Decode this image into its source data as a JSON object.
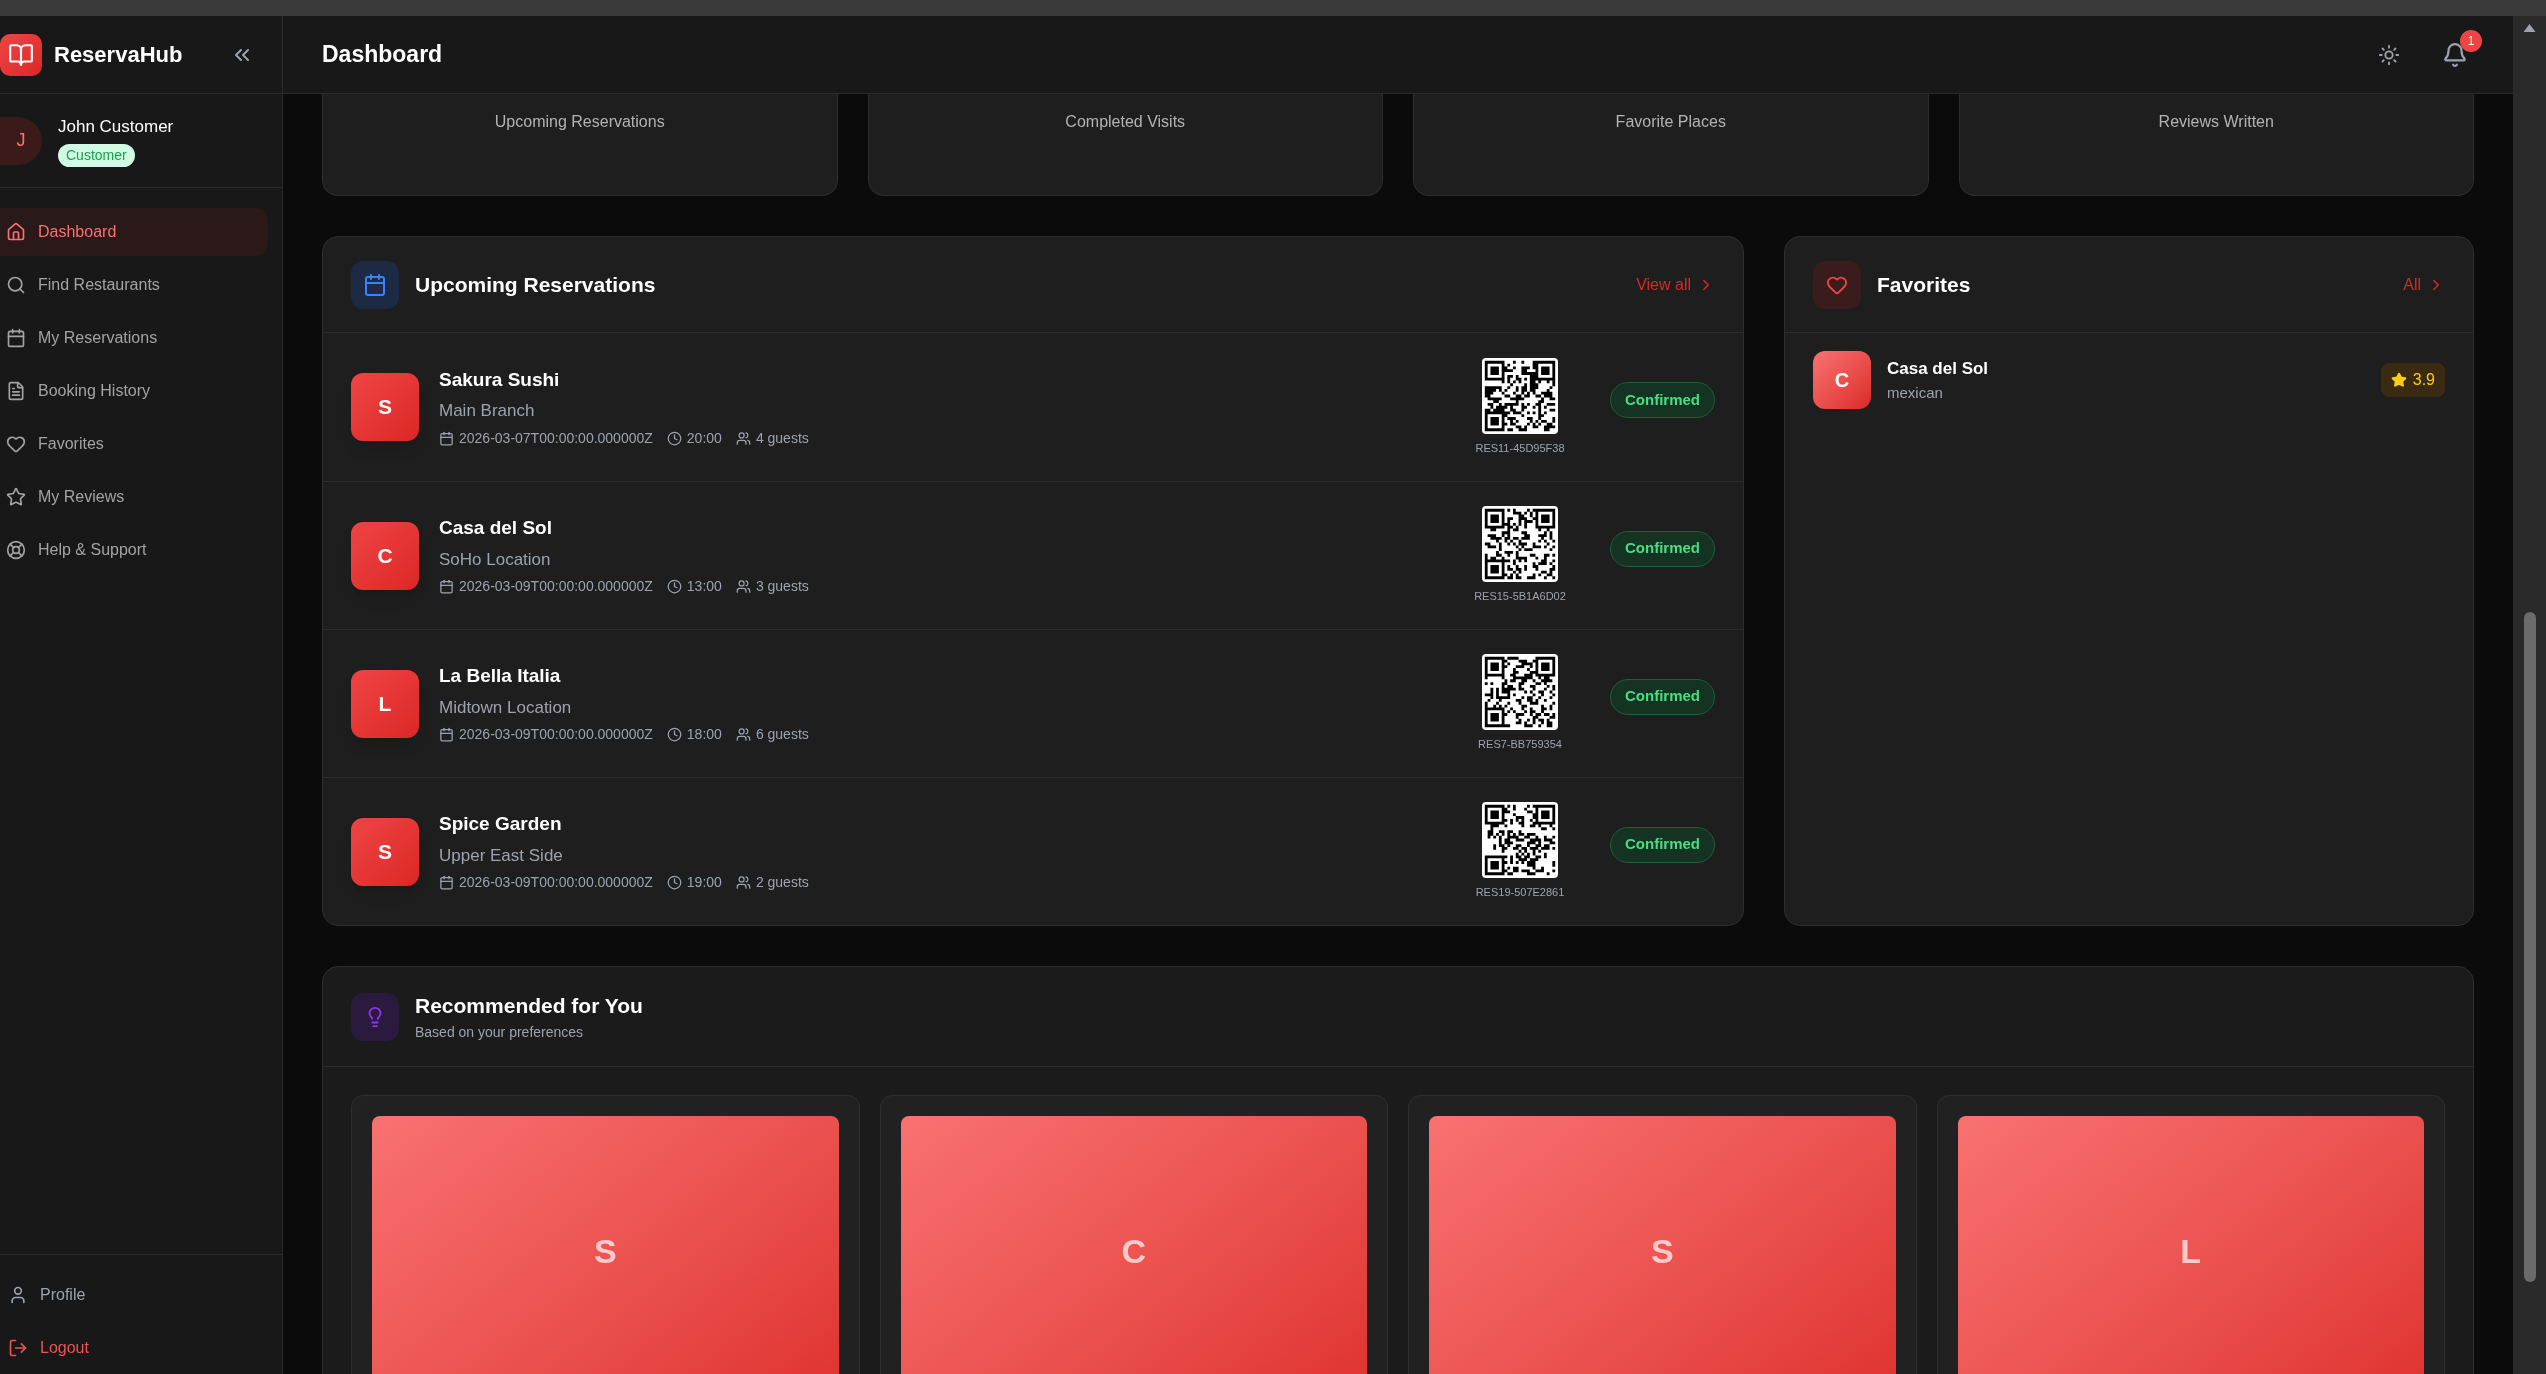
{
  "brand": {
    "name": "ReservaHub"
  },
  "user": {
    "initial": "J",
    "name": "John Customer",
    "role": "Customer"
  },
  "nav": [
    {
      "label": "Dashboard",
      "selected": true
    },
    {
      "label": "Find Restaurants",
      "selected": false
    },
    {
      "label": "My Reservations",
      "selected": false
    },
    {
      "label": "Booking History",
      "selected": false
    },
    {
      "label": "Favorites",
      "selected": false
    },
    {
      "label": "My Reviews",
      "selected": false
    },
    {
      "label": "Help & Support",
      "selected": false
    }
  ],
  "footer_nav": [
    {
      "label": "Profile",
      "kind": "profile"
    },
    {
      "label": "Logout",
      "kind": "logout"
    }
  ],
  "header": {
    "title": "Dashboard",
    "notifications": "1"
  },
  "stats": [
    "Upcoming Reservations",
    "Completed Visits",
    "Favorite Places",
    "Reviews Written"
  ],
  "reservations": {
    "title": "Upcoming Reservations",
    "link": "View all",
    "items": [
      {
        "initial": "S",
        "name": "Sakura Sushi",
        "location": "Main Branch",
        "date": "2026-03-07T00:00:00.000000Z",
        "time": "20:00",
        "guests": "4 guests",
        "code": "RES11-45D95F38",
        "status": "Confirmed"
      },
      {
        "initial": "C",
        "name": "Casa del Sol",
        "location": "SoHo Location",
        "date": "2026-03-09T00:00:00.000000Z",
        "time": "13:00",
        "guests": "3 guests",
        "code": "RES15-5B1A6D02",
        "status": "Confirmed"
      },
      {
        "initial": "L",
        "name": "La Bella Italia",
        "location": "Midtown Location",
        "date": "2026-03-09T00:00:00.000000Z",
        "time": "18:00",
        "guests": "6 guests",
        "code": "RES7-BB759354",
        "status": "Confirmed"
      },
      {
        "initial": "S",
        "name": "Spice Garden",
        "location": "Upper East Side",
        "date": "2026-03-09T00:00:00.000000Z",
        "time": "19:00",
        "guests": "2 guests",
        "code": "RES19-507E2861",
        "status": "Confirmed"
      }
    ]
  },
  "favorites": {
    "title": "Favorites",
    "link": "All",
    "items": [
      {
        "initial": "C",
        "name": "Casa del Sol",
        "cuisine": "mexican",
        "rating": "3.9"
      }
    ]
  },
  "recommended": {
    "title": "Recommended for You",
    "subtitle": "Based on your preferences",
    "items": [
      {
        "initial": "S"
      },
      {
        "initial": "C"
      },
      {
        "initial": "S"
      },
      {
        "initial": "L"
      }
    ]
  }
}
